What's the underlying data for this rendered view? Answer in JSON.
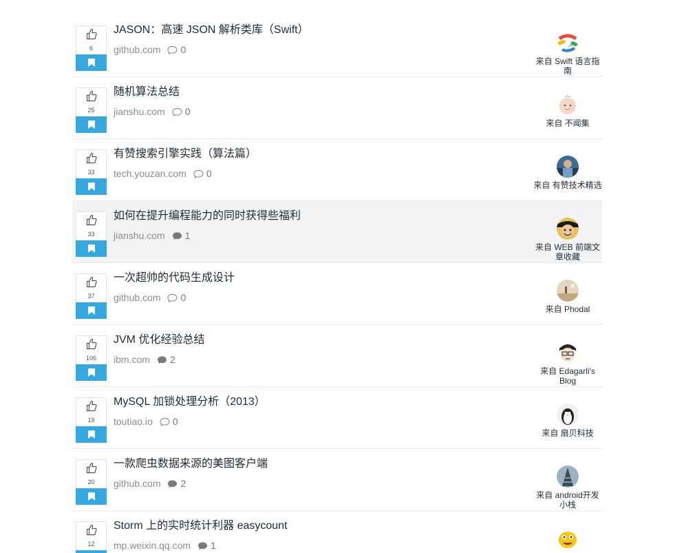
{
  "from_label": "来自",
  "items": [
    {
      "title": "JASON：高速 JSON 解析类库（Swift）",
      "domain": "github.com",
      "votes": "6",
      "comments": "0",
      "has_comments": false,
      "source": "Swift 语言指南",
      "highlight": false,
      "avatar": "avatar-swift"
    },
    {
      "title": "随机算法总结",
      "domain": "jianshu.com",
      "votes": "25",
      "comments": "0",
      "has_comments": false,
      "source": "不闻集",
      "highlight": false,
      "avatar": "avatar-baby"
    },
    {
      "title": "有赞搜索引擎实践（算法篇）",
      "domain": "tech.youzan.com",
      "votes": "33",
      "comments": "0",
      "has_comments": false,
      "source": "有赞技术精选",
      "highlight": false,
      "avatar": "avatar-photo"
    },
    {
      "title": "如何在提升编程能力的同时获得些福利",
      "domain": "jianshu.com",
      "votes": "33",
      "comments": "1",
      "has_comments": true,
      "source": "WEB 前端文章收藏",
      "highlight": true,
      "avatar": "avatar-luffy"
    },
    {
      "title": "一次超帅的代码生成设计",
      "domain": "github.com",
      "votes": "37",
      "comments": "0",
      "has_comments": false,
      "source": "Phodal",
      "highlight": false,
      "avatar": "avatar-landscape"
    },
    {
      "title": "JVM 优化经验总结",
      "domain": "ibm.com",
      "votes": "106",
      "comments": "2",
      "has_comments": true,
      "source": "Edagarli's Blog",
      "highlight": false,
      "avatar": "avatar-cartoon"
    },
    {
      "title": "MySQL 加锁处理分析（2013）",
      "domain": "toutiao.io",
      "votes": "19",
      "comments": "0",
      "has_comments": false,
      "source": "扇贝科技",
      "highlight": false,
      "avatar": "avatar-penguin"
    },
    {
      "title": "一款爬虫数据来源的美图客户端",
      "domain": "github.com",
      "votes": "20",
      "comments": "2",
      "has_comments": true,
      "source": "android开发小栈",
      "highlight": false,
      "avatar": "avatar-tower"
    },
    {
      "title": "Storm 上的实时统计利器 easycount",
      "domain": "mp.weixin.qq.com",
      "votes": "12",
      "comments": "1",
      "has_comments": true,
      "source": "",
      "highlight": false,
      "avatar": "avatar-mm"
    }
  ],
  "colors": {
    "accent": "#35a8e0",
    "title": "#1d2b3a",
    "meta": "#8c8c8c",
    "highlight_bg": "#f2f3f5"
  }
}
